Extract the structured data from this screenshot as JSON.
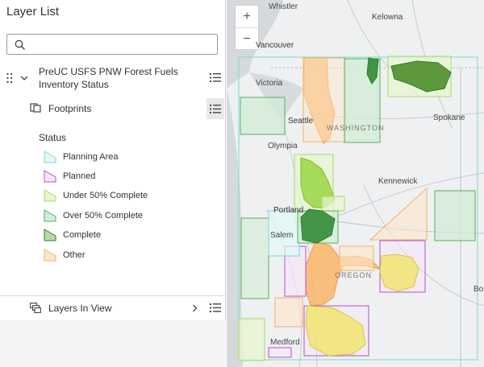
{
  "panel": {
    "title": "Layer List",
    "search_placeholder": "",
    "group_layer": "PreUC USFS PNW Forest Fuels Inventory Status",
    "footprints": "Footprints",
    "status_heading": "Status",
    "legend": [
      {
        "label": "Planning Area",
        "fill": "#e0faf7",
        "stroke": "#7fd8cf"
      },
      {
        "label": "Planned",
        "fill": "#f6e6fa",
        "stroke": "#b44fd0"
      },
      {
        "label": "Under 50% Complete",
        "fill": "#e8f5cf",
        "stroke": "#a9d86c"
      },
      {
        "label": "Over 50% Complete",
        "fill": "#d2ecd6",
        "stroke": "#5aae61"
      },
      {
        "label": "Complete",
        "fill": "#b7d8a6",
        "stroke": "#2e7d32"
      },
      {
        "label": "Other",
        "fill": "#fde6cc",
        "stroke": "#f1b26d"
      }
    ],
    "layers_in_view": "Layers In View"
  },
  "map": {
    "zoom_in": "+",
    "zoom_out": "−",
    "places": [
      {
        "name": "Whistler"
      },
      {
        "name": "Kelowna"
      },
      {
        "name": "Vancouver"
      },
      {
        "name": "Victoria"
      },
      {
        "name": "Seattle"
      },
      {
        "name": "WASHINGTON"
      },
      {
        "name": "Spokane"
      },
      {
        "name": "Olympia"
      },
      {
        "name": "Kennewick"
      },
      {
        "name": "Portland"
      },
      {
        "name": "Salem"
      },
      {
        "name": "OREGON"
      },
      {
        "name": "Medford"
      },
      {
        "name": "Bo"
      }
    ]
  },
  "colors": {
    "planning": "#7fd8cf",
    "planned": "#b44fd0",
    "under50": "#a9d86c",
    "over50": "#5aae61",
    "complete": "#2e7d32",
    "other": "#f1b26d"
  }
}
